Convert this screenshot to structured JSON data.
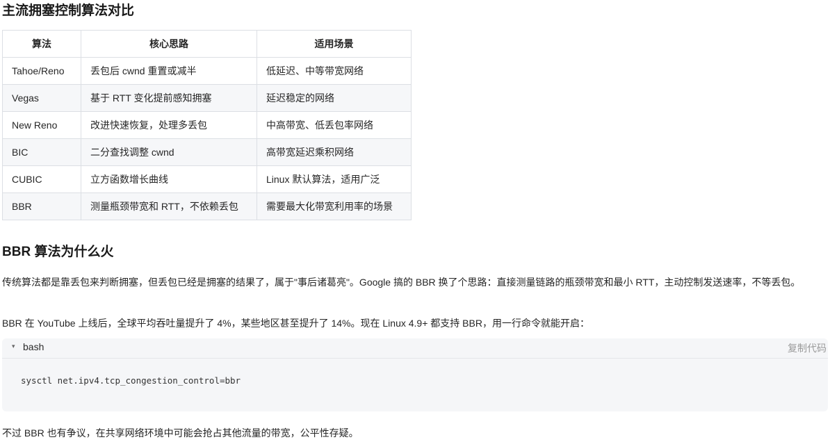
{
  "section1": {
    "title": "主流拥塞控制算法对比",
    "table": {
      "headers": [
        "算法",
        "核心思路",
        "适用场景"
      ],
      "rows": [
        [
          "Tahoe/Reno",
          "丢包后 cwnd 重置或减半",
          "低延迟、中等带宽网络"
        ],
        [
          "Vegas",
          "基于 RTT 变化提前感知拥塞",
          "延迟稳定的网络"
        ],
        [
          "New Reno",
          "改进快速恢复，处理多丢包",
          "中高带宽、低丢包率网络"
        ],
        [
          "BIC",
          "二分查找调整 cwnd",
          "高带宽延迟乘积网络"
        ],
        [
          "CUBIC",
          "立方函数增长曲线",
          "Linux 默认算法，适用广泛"
        ],
        [
          "BBR",
          "测量瓶颈带宽和 RTT，不依赖丢包",
          "需要最大化带宽利用率的场景"
        ]
      ]
    }
  },
  "section2": {
    "title": "BBR 算法为什么火",
    "para1": "传统算法都是靠丢包来判断拥塞，但丢包已经是拥塞的结果了，属于\"事后诸葛亮\"。Google 搞的 BBR 换了个思路：直接测量链路的瓶颈带宽和最小 RTT，主动控制发送速率，不等丢包。",
    "para2": "BBR 在 YouTube 上线后，全球平均吞吐量提升了 4%，某些地区甚至提升了 14%。现在 Linux 4.9+ 都支持 BBR，用一行命令就能开启：",
    "code": {
      "language": "bash",
      "copy_label": "复制代码",
      "caret_icon": "▾",
      "content": "sysctl net.ipv4.tcp_congestion_control=bbr"
    },
    "para3": "不过 BBR 也有争议，在共享网络环境中可能会抢占其他流量的带宽，公平性存疑。"
  }
}
